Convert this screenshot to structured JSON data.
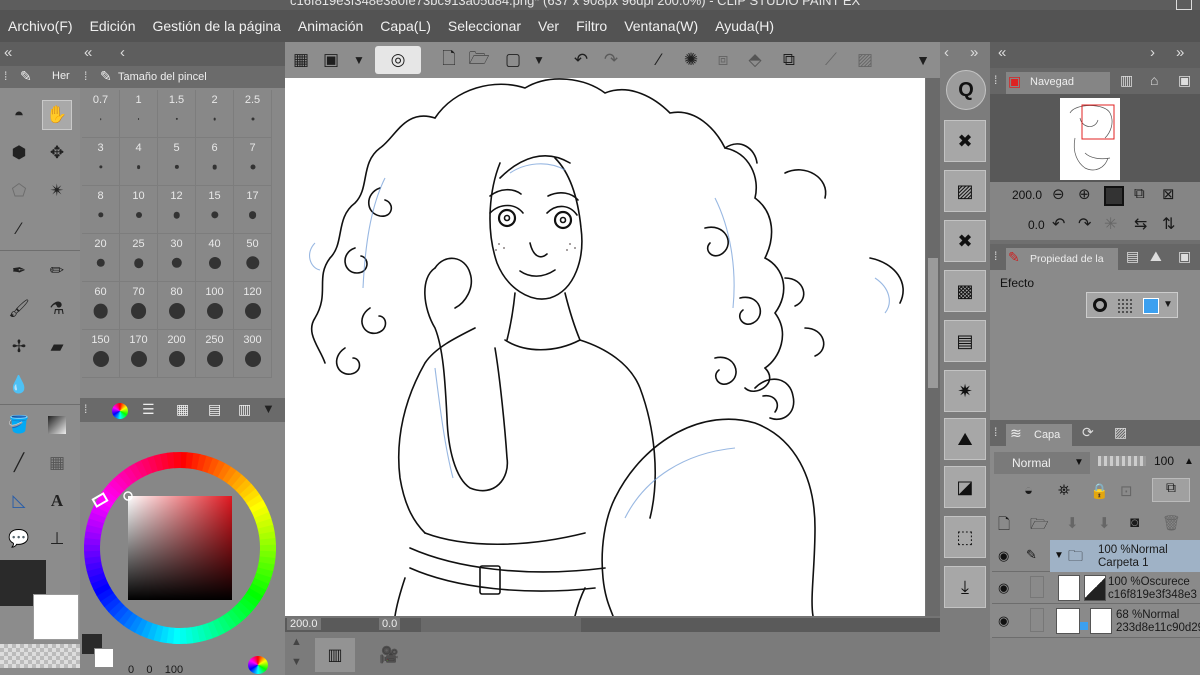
{
  "window": {
    "title": "c16f819e3f348e380fe73bc913a05d84.png* (637 x 908px 96dpi 200.0%)  - CLIP STUDIO PAINT EX"
  },
  "menu": [
    "Archivo(F)",
    "Edición",
    "Gestión de la página",
    "Animación",
    "Capa(L)",
    "Seleccionar",
    "Ver",
    "Filtro",
    "Ventana(W)",
    "Ayuda(H)"
  ],
  "tool_panel": {
    "tab_label": "Her"
  },
  "brush_size_panel": {
    "title": "Tamaño del pincel",
    "sizes": [
      "0.7",
      "1",
      "1.5",
      "2",
      "2.5",
      "3",
      "4",
      "5",
      "6",
      "7",
      "8",
      "10",
      "12",
      "15",
      "17",
      "20",
      "25",
      "30",
      "40",
      "50",
      "60",
      "70",
      "80",
      "100",
      "120",
      "150",
      "170",
      "200",
      "250",
      "300"
    ]
  },
  "color_panel": {
    "bottom_values": [
      "0",
      "0",
      "100"
    ]
  },
  "canvas": {
    "zoom": "200.0",
    "rotation": "0.0"
  },
  "navigator": {
    "tab_label": "Navegad",
    "zoom": "200.0",
    "rotation": "0.0"
  },
  "layer_property": {
    "tab_label": "Propiedad de la",
    "effect_label": "Efecto"
  },
  "layers_panel": {
    "tab_label": "Capa",
    "blend_mode": "Normal",
    "opacity": "100",
    "layers": [
      {
        "line1": "100 %Normal",
        "line2": "Carpeta 1"
      },
      {
        "line1": "100 %Oscurece",
        "line2": "c16f819e3f348e3"
      },
      {
        "line1": "68 %Normal",
        "line2": "233d8e11c90d29"
      }
    ]
  },
  "colors": {
    "main": "#2a2a2a",
    "sub": "#ffffff",
    "accent_blue": "#3ba0f0",
    "selected_row": "#9fb2c6"
  },
  "icons": {
    "hand": "hand-icon",
    "eyedropper": "eyedropper-icon",
    "eye": "eye-icon",
    "folder": "folder-icon"
  }
}
